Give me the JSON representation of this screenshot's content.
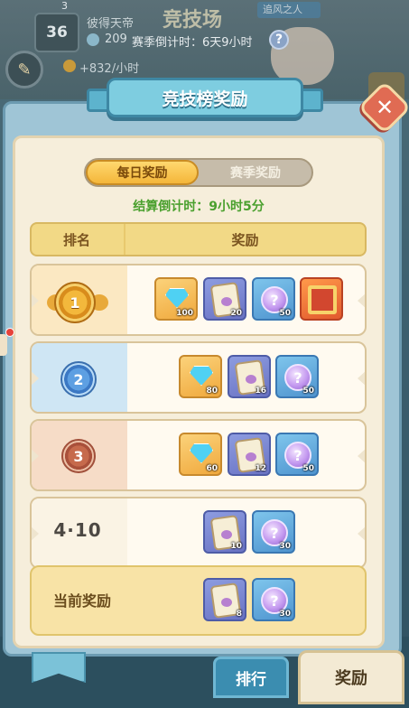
{
  "topbar": {
    "level": "36",
    "level_small": "3",
    "player_name": "彼得天帝",
    "power": "209",
    "arena_title": "竞技场",
    "season_countdown": "赛季倒计时：6天9小时",
    "help": "?",
    "rate": "+832/小时",
    "banner": "追风之人"
  },
  "dialog": {
    "title": "竞技榜奖励",
    "close": "✕",
    "tabs": {
      "daily": "每日奖励",
      "season": "赛季奖励",
      "selected": "daily"
    },
    "settle_countdown": "结算倒计时：9小时5分",
    "header": {
      "rank": "排名",
      "reward": "奖励"
    },
    "rows": [
      {
        "rank": "1",
        "items": [
          {
            "type": "diamond",
            "qty": "100"
          },
          {
            "type": "card",
            "qty": "20"
          },
          {
            "type": "mystery-orb",
            "qty": "50"
          },
          {
            "type": "avatar-frame",
            "qty": ""
          }
        ]
      },
      {
        "rank": "2",
        "items": [
          {
            "type": "diamond",
            "qty": "80"
          },
          {
            "type": "card",
            "qty": "16"
          },
          {
            "type": "mystery-orb",
            "qty": "50"
          }
        ]
      },
      {
        "rank": "3",
        "items": [
          {
            "type": "diamond",
            "qty": "60"
          },
          {
            "type": "card",
            "qty": "12"
          },
          {
            "type": "mystery-orb",
            "qty": "50"
          }
        ]
      },
      {
        "rank": "4-10",
        "label": "4·10",
        "items": [
          {
            "type": "card",
            "qty": "10"
          },
          {
            "type": "mystery-orb",
            "qty": "30"
          }
        ]
      }
    ],
    "current": {
      "label": "当前奖励",
      "items": [
        {
          "type": "card",
          "qty": "8"
        },
        {
          "type": "mystery-orb",
          "qty": "30"
        }
      ]
    }
  },
  "bottom_tabs": {
    "rank": "排行",
    "reward": "奖励"
  },
  "colors": {
    "accent_gold": "#f4b63a",
    "panel_blue": "#9fc5d6",
    "countdown_green": "#4aa02e"
  }
}
